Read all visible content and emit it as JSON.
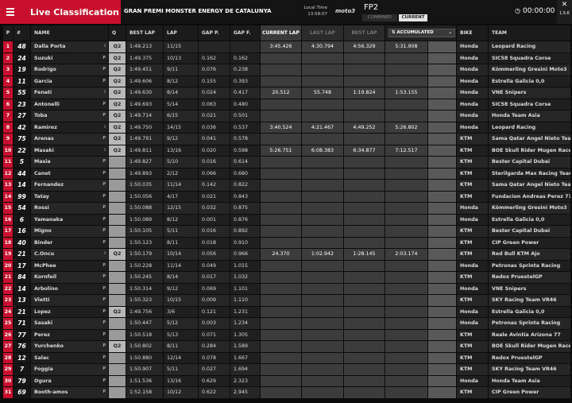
{
  "header": {
    "title": "Live Classification",
    "event": "GRAN PREMI MONSTER ENERGY DE CATALUNYA",
    "local_time_label": "Local Time",
    "local_time": "13:58:07",
    "logo": "moto3",
    "session": "FP2",
    "combined": "COMBINED",
    "current": "CURRENT",
    "clock": "00:00:00",
    "close": "✕",
    "version": "1.5.6"
  },
  "columns": {
    "pos": "P",
    "num": "#",
    "name": "NAME",
    "q": "Q",
    "best_lap": "BEST LAP",
    "lap": "LAP",
    "gap_p": "GAP P.",
    "gap_f": "GAP F.",
    "current_lap": "CURRENT LAP",
    "last_lap": "LAST LAP",
    "best_lap2": "BEST LAP",
    "accumulated": "ACCUMULATED",
    "bike": "BIKE",
    "team": "TEAM"
  },
  "rows": [
    {
      "p": "1",
      "n": "48",
      "name": "Dalla Porta",
      "flag": "⁝",
      "q": "Q2",
      "best": "1:49.213",
      "lap": "11/15",
      "gp": "",
      "gf": "",
      "s": [
        "3:45.426",
        "4:30.794",
        "4:56.329",
        "5:31.908"
      ],
      "bike": "Honda",
      "team": "Leopard Racing"
    },
    {
      "p": "2",
      "n": "24",
      "name": "Suzuki",
      "flag": "P",
      "q": "Q2",
      "best": "1:49.375",
      "lap": "10/13",
      "gp": "0.162",
      "gf": "0.162",
      "s": [],
      "bike": "Honda",
      "team": "SIC58 Squadra Corse"
    },
    {
      "p": "3",
      "n": "19",
      "name": "Rodrigo",
      "flag": "P",
      "q": "Q2",
      "best": "1:49.451",
      "lap": "9/11",
      "gp": "0.076",
      "gf": "0.238",
      "s": [],
      "bike": "Honda",
      "team": "Kömmerling Gresini Moto3"
    },
    {
      "p": "4",
      "n": "11",
      "name": "Garcia",
      "flag": "P",
      "q": "Q2",
      "best": "1:49.606",
      "lap": "8/12",
      "gp": "0.155",
      "gf": "0.393",
      "s": [],
      "bike": "Honda",
      "team": "Estrella Galicia 0,0"
    },
    {
      "p": "5",
      "n": "55",
      "name": "Fenati",
      "flag": "⁝",
      "q": "Q2",
      "best": "1:49.630",
      "lap": "8/14",
      "gp": "0.024",
      "gf": "0.417",
      "s": [
        "20.512",
        "55.748",
        "1:19.824",
        "1:53.155"
      ],
      "bike": "Honda",
      "team": "VNE Snipers"
    },
    {
      "p": "6",
      "n": "23",
      "name": "Antonelli",
      "flag": "P",
      "q": "Q2",
      "best": "1:49.693",
      "lap": "5/14",
      "gp": "0.063",
      "gf": "0.480",
      "s": [],
      "bike": "Honda",
      "team": "SIC58 Squadra Corse"
    },
    {
      "p": "7",
      "n": "27",
      "name": "Toba",
      "flag": "P",
      "q": "Q2",
      "best": "1:49.714",
      "lap": "6/15",
      "gp": "0.021",
      "gf": "0.501",
      "s": [],
      "bike": "Honda",
      "team": "Honda Team Asia"
    },
    {
      "p": "8",
      "n": "42",
      "name": "Ramirez",
      "flag": "⁝",
      "q": "Q2",
      "best": "1:49.750",
      "lap": "14/15",
      "gp": "0.036",
      "gf": "0.537",
      "s": [
        "3:40.524",
        "4:21.467",
        "4:49.252",
        "5:26.802"
      ],
      "bike": "Honda",
      "team": "Leopard Racing"
    },
    {
      "p": "9",
      "n": "75",
      "name": "Arenas",
      "flag": "P",
      "q": "Q2",
      "best": "1:49.791",
      "lap": "9/12",
      "gp": "0.041",
      "gf": "0.578",
      "s": [],
      "bike": "KTM",
      "team": "Sama Qatar Angel Nieto Team"
    },
    {
      "p": "10",
      "n": "22",
      "name": "Masaki",
      "flag": "⁝",
      "q": "Q2",
      "best": "1:49.811",
      "lap": "13/16",
      "gp": "0.020",
      "gf": "0.598",
      "s": [
        "5:26.751",
        "6:08.383",
        "6:34.877",
        "7:12.517"
      ],
      "bike": "KTM",
      "team": "BOE Skull Rider Mugen Race"
    },
    {
      "p": "11",
      "n": "5",
      "name": "Masia",
      "flag": "P",
      "q": "",
      "best": "1:49.827",
      "lap": "5/10",
      "gp": "0.016",
      "gf": "0.614",
      "s": [],
      "bike": "KTM",
      "team": "Bester Capital Dubai"
    },
    {
      "p": "12",
      "n": "44",
      "name": "Canet",
      "flag": "P",
      "q": "",
      "best": "1:49.893",
      "lap": "2/12",
      "gp": "0.066",
      "gf": "0.680",
      "s": [],
      "bike": "KTM",
      "team": "Sterilgarda Max Racing Team"
    },
    {
      "p": "13",
      "n": "14",
      "name": "Fernandez",
      "flag": "P",
      "q": "",
      "best": "1:50.035",
      "lap": "11/14",
      "gp": "0.142",
      "gf": "0.822",
      "s": [],
      "bike": "KTM",
      "team": "Sama Qatar Angel Nieto Team"
    },
    {
      "p": "14",
      "n": "99",
      "name": "Tatay",
      "flag": "P",
      "q": "",
      "best": "1:50.056",
      "lap": "4/17",
      "gp": "0.021",
      "gf": "0.843",
      "s": [],
      "bike": "KTM",
      "team": "Fundacion Andreas Perez 77"
    },
    {
      "p": "15",
      "n": "54",
      "name": "Rossi",
      "flag": "P",
      "q": "",
      "best": "1:50.088",
      "lap": "12/15",
      "gp": "0.032",
      "gf": "0.875",
      "s": [],
      "bike": "Honda",
      "team": "Kömmerling Gresini Moto3"
    },
    {
      "p": "16",
      "n": "6",
      "name": "Yamanaka",
      "flag": "P",
      "q": "",
      "best": "1:50.089",
      "lap": "8/12",
      "gp": "0.001",
      "gf": "0.876",
      "s": [],
      "bike": "Honda",
      "team": "Estrella Galicia 0,0"
    },
    {
      "p": "17",
      "n": "16",
      "name": "Migno",
      "flag": "P",
      "q": "",
      "best": "1:50.105",
      "lap": "5/11",
      "gp": "0.016",
      "gf": "0.892",
      "s": [],
      "bike": "KTM",
      "team": "Bester Capital Dubai"
    },
    {
      "p": "18",
      "n": "40",
      "name": "Binder",
      "flag": "P",
      "q": "",
      "best": "1:50.123",
      "lap": "8/11",
      "gp": "0.018",
      "gf": "0.910",
      "s": [],
      "bike": "KTM",
      "team": "CIP Green Power"
    },
    {
      "p": "19",
      "n": "21",
      "name": "C.Oncu",
      "flag": "⁝",
      "q": "Q2",
      "best": "1:50.179",
      "lap": "10/14",
      "gp": "0.056",
      "gf": "0.966",
      "s": [
        "24.370",
        "1:02.942",
        "1:28.145",
        "2:03.174"
      ],
      "bike": "KTM",
      "team": "Red Bull KTM Ajo"
    },
    {
      "p": "20",
      "n": "17",
      "name": "McPhee",
      "flag": "P",
      "q": "",
      "best": "1:50.228",
      "lap": "11/14",
      "gp": "0.049",
      "gf": "1.015",
      "s": [],
      "bike": "Honda",
      "team": "Petronas Sprinta Racing"
    },
    {
      "p": "21",
      "n": "84",
      "name": "Kornfeil",
      "flag": "P",
      "q": "",
      "best": "1:50.245",
      "lap": "8/14",
      "gp": "0.017",
      "gf": "1.032",
      "s": [],
      "bike": "KTM",
      "team": "Redox PruestelGP"
    },
    {
      "p": "22",
      "n": "14",
      "name": "Arbolino",
      "flag": "P",
      "q": "",
      "best": "1:50.314",
      "lap": "9/12",
      "gp": "0.069",
      "gf": "1.101",
      "s": [],
      "bike": "Honda",
      "team": "VNE Snipers"
    },
    {
      "p": "23",
      "n": "13",
      "name": "Vietti",
      "flag": "P",
      "q": "",
      "best": "1:50.323",
      "lap": "10/15",
      "gp": "0.009",
      "gf": "1.110",
      "s": [],
      "bike": "KTM",
      "team": "SKY Racing Team VR46"
    },
    {
      "p": "24",
      "n": "21",
      "name": "Lopez",
      "flag": "P",
      "q": "Q2",
      "best": "1:49.756",
      "lap": "3/6",
      "gp": "0.121",
      "gf": "1.231",
      "s": [],
      "bike": "Honda",
      "team": "Estrella Galicia 0,0"
    },
    {
      "p": "25",
      "n": "71",
      "name": "Sasaki",
      "flag": "P",
      "q": "",
      "best": "1:50.447",
      "lap": "5/12",
      "gp": "0.003",
      "gf": "1.234",
      "s": [],
      "bike": "Honda",
      "team": "Petronas Sprinta Racing"
    },
    {
      "p": "26",
      "n": "77",
      "name": "Perez",
      "flag": "P",
      "q": "",
      "best": "1:50.518",
      "lap": "5/13",
      "gp": "0.071",
      "gf": "1.305",
      "s": [],
      "bike": "KTM",
      "team": "Reale Avintia Arizona 77"
    },
    {
      "p": "27",
      "n": "76",
      "name": "Yurchenko",
      "flag": "P",
      "q": "Q2",
      "best": "1:50.802",
      "lap": "8/11",
      "gp": "0.284",
      "gf": "1.589",
      "s": [],
      "bike": "KTM",
      "team": "BOE Skull Rider Mugen Race"
    },
    {
      "p": "28",
      "n": "12",
      "name": "Salac",
      "flag": "P",
      "q": "",
      "best": "1:50.880",
      "lap": "12/14",
      "gp": "0.078",
      "gf": "1.667",
      "s": [],
      "bike": "KTM",
      "team": "Redox PruestelGP"
    },
    {
      "p": "29",
      "n": "7",
      "name": "Foggia",
      "flag": "P",
      "q": "",
      "best": "1:50.907",
      "lap": "5/11",
      "gp": "0.027",
      "gf": "1.694",
      "s": [],
      "bike": "KTM",
      "team": "SKY Racing Team VR46"
    },
    {
      "p": "30",
      "n": "79",
      "name": "Ogura",
      "flag": "P",
      "q": "",
      "best": "1:51.536",
      "lap": "13/16",
      "gp": "0.629",
      "gf": "2.323",
      "s": [],
      "bike": "Honda",
      "team": "Honda Team Asia"
    },
    {
      "p": "31",
      "n": "69",
      "name": "Booth-amos",
      "flag": "P",
      "q": "",
      "best": "1:52.158",
      "lap": "10/12",
      "gp": "0.622",
      "gf": "2.945",
      "s": [],
      "bike": "KTM",
      "team": "CIP Green Power"
    }
  ]
}
